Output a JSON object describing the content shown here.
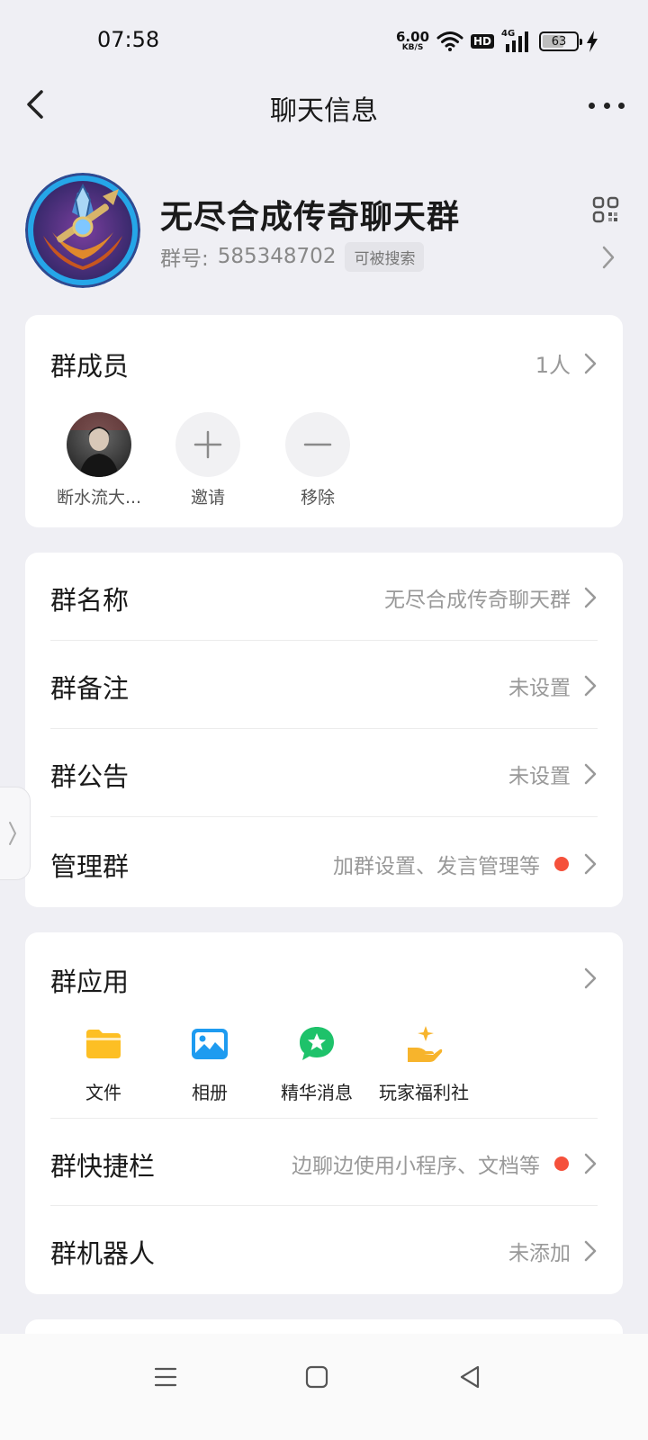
{
  "status_bar": {
    "time": "07:58",
    "net_speed": "6.00",
    "net_speed_unit": "KB/S",
    "hd_badge": "HD",
    "signal_label": "4G",
    "battery_level": "63",
    "battery_fraction": 0.63,
    "charging": true
  },
  "header": {
    "title": "聊天信息",
    "back_icon": "chevron-left-icon",
    "more_icon": "more-horizontal-icon"
  },
  "group": {
    "name": "无尽合成传奇聊天群",
    "id_label": "群号:",
    "id_value": "585348702",
    "search_badge": "可被搜索"
  },
  "members": {
    "title": "群成员",
    "count": "1人",
    "items": [
      {
        "label": "断水流大..."
      },
      {
        "label": "邀请",
        "icon": "plus-icon"
      },
      {
        "label": "移除",
        "icon": "minus-icon"
      }
    ]
  },
  "settings": [
    {
      "label": "群名称",
      "value": "无尽合成传奇聊天群",
      "dot": false
    },
    {
      "label": "群备注",
      "value": "未设置",
      "dot": false
    },
    {
      "label": "群公告",
      "value": "未设置",
      "dot": false
    },
    {
      "label": "管理群",
      "value": "加群设置、发言管理等",
      "dot": true
    }
  ],
  "apps": {
    "title": "群应用",
    "items": [
      {
        "label": "文件",
        "icon": "folder-icon"
      },
      {
        "label": "相册",
        "icon": "photo-icon"
      },
      {
        "label": "精华消息",
        "icon": "star-chat-icon"
      },
      {
        "label": "玩家福利社",
        "icon": "gift-hand-icon"
      }
    ],
    "rows": [
      {
        "label": "群快捷栏",
        "value": "边聊边使用小程序、文档等",
        "dot": true
      },
      {
        "label": "群机器人",
        "value": "未添加",
        "dot": false
      }
    ]
  },
  "colors": {
    "background": "#efeff4",
    "card": "#ffffff",
    "accent_red": "#f5513b",
    "folder_yellow": "#fdbf24",
    "photo_blue": "#1e9bf0",
    "chat_green": "#1ec26a",
    "gift_orange": "#f7b42c"
  }
}
